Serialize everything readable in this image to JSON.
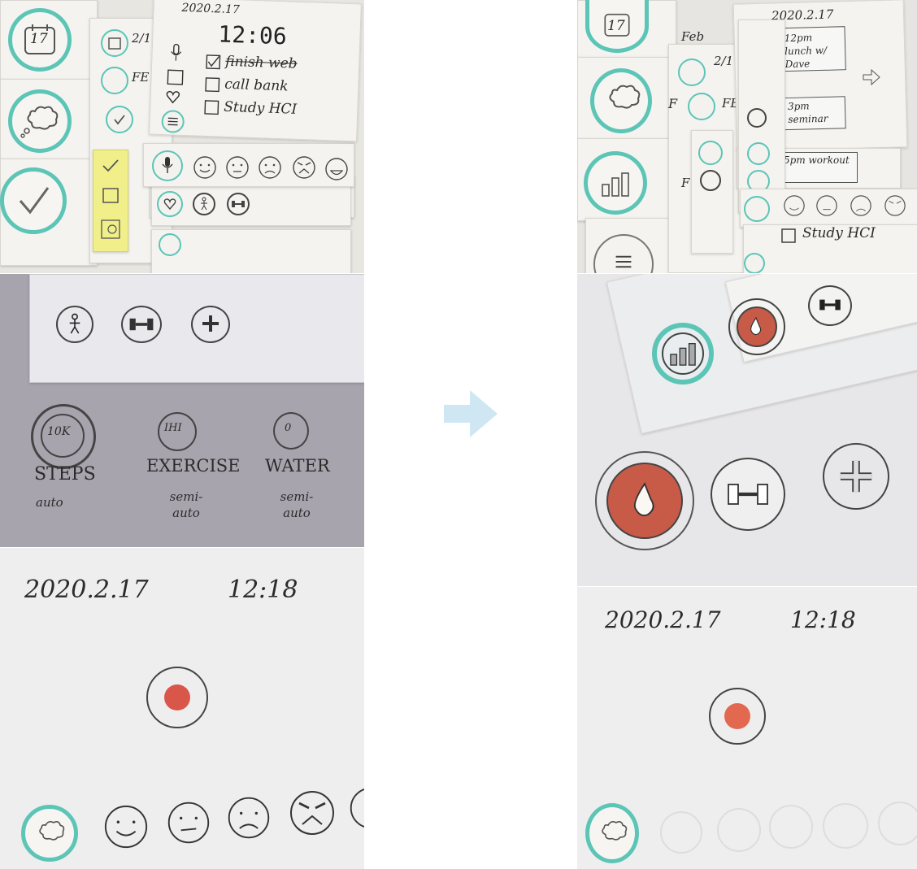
{
  "accent_colors": {
    "teal": "#5cc5b6",
    "red_dot": "#d8574a",
    "water_red": "#c85a48",
    "arrow_blue": "#cfe7f3",
    "sticky_yellow": "#f1ef8a"
  },
  "top_left": {
    "calendar_day": "17",
    "date": "2020.2.17",
    "time": "12:06",
    "todos": [
      "finish web",
      "call bank",
      "Study HCI"
    ],
    "side_text": [
      "2/1",
      "FE"
    ]
  },
  "top_right": {
    "calendar_day": "17",
    "date": "2020.2.17",
    "events": [
      "12pm lunch w/ Dave",
      "3pm seminar",
      "5pm workout"
    ],
    "todo": "Study HCI",
    "side_text": [
      "Feb",
      "2/1",
      "F",
      "FE",
      "F"
    ]
  },
  "middle_left": {
    "metrics": [
      {
        "badge": "10K",
        "name": "STEPS",
        "mode": "auto"
      },
      {
        "badge": "IHI",
        "name": "EXERCISE",
        "mode": "semi-auto"
      },
      {
        "badge": "0",
        "name": "WATER",
        "mode": "semi-auto"
      }
    ]
  },
  "bottom_left": {
    "date": "2020.2.17",
    "time": "12:18"
  },
  "bottom_right": {
    "date": "2020.2.17",
    "time": "12:18"
  },
  "icons": [
    "calendar-icon",
    "thought-bubble-icon",
    "check-icon",
    "mic-icon",
    "heart-icon",
    "menu-icon",
    "stick-figure-icon",
    "dumbbell-icon",
    "plus-icon",
    "water-drop-icon",
    "record-button-icon",
    "bar-chart-icon",
    "arrow-right-icon"
  ]
}
